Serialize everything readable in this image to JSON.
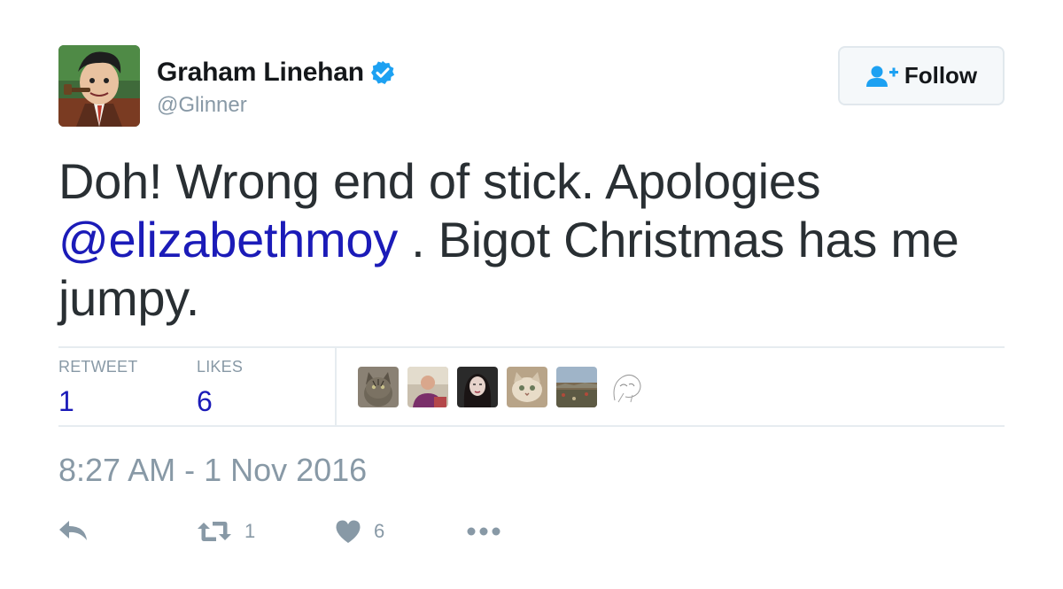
{
  "author": {
    "display_name": "Graham Linehan",
    "handle": "@Glinner",
    "verified": true,
    "avatar_icon": "caricature-avatar"
  },
  "follow_button": {
    "label": "Follow",
    "icon": "add-user-icon"
  },
  "tweet": {
    "text_before_mention": "Doh! Wrong end of stick. Apologies ",
    "mention": "@elizabethmoy",
    "text_after_mention": " . Bigot Christmas has me jumpy."
  },
  "stats": {
    "retweet_label": "RETWEET",
    "retweet_count": "1",
    "likes_label": "LIKES",
    "likes_count": "6"
  },
  "likers": [
    {
      "name": "cat-avatar"
    },
    {
      "name": "person-avatar"
    },
    {
      "name": "woman-avatar"
    },
    {
      "name": "cat-photo-avatar"
    },
    {
      "name": "landscape-avatar"
    },
    {
      "name": "sketch-avatar"
    }
  ],
  "timestamp": "8:27 AM - 1 Nov 2016",
  "actions": {
    "reply_icon": "reply-icon",
    "retweet_icon": "retweet-icon",
    "retweet_count": "1",
    "like_icon": "heart-icon",
    "like_count": "6",
    "more_icon": "more-icon"
  },
  "colors": {
    "link": "#1b1bb8",
    "verified": "#1da1f2",
    "muted": "#8899a6",
    "text": "#292f33",
    "divider": "#e6ecf0"
  }
}
